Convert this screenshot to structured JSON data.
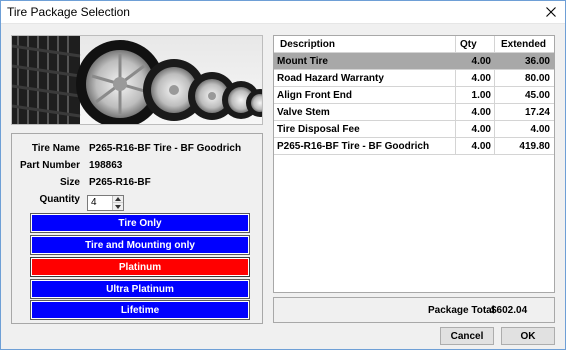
{
  "window": {
    "title": "Tire Package Selection",
    "close_icon": "close-icon"
  },
  "tire_info": {
    "tire_name_label": "Tire Name",
    "tire_name": "P265-R16-BF Tire - BF Goodrich",
    "part_number_label": "Part Number",
    "part_number": "198863",
    "size_label": "Size",
    "size": "P265-R16-BF",
    "quantity_label": "Quantity",
    "quantity": "4"
  },
  "packages": [
    {
      "label": "Tire Only",
      "selected": false
    },
    {
      "label": "Tire and Mounting only",
      "selected": false
    },
    {
      "label": "Platinum",
      "selected": true
    },
    {
      "label": "Ultra Platinum",
      "selected": false
    },
    {
      "label": "Lifetime",
      "selected": false
    }
  ],
  "grid": {
    "columns": [
      "Description",
      "Qty",
      "Extended"
    ],
    "rows": [
      {
        "description": "Mount Tire",
        "qty": "4.00",
        "extended": "36.00"
      },
      {
        "description": "Road Hazard Warranty",
        "qty": "4.00",
        "extended": "80.00"
      },
      {
        "description": "Align Front End",
        "qty": "1.00",
        "extended": "45.00"
      },
      {
        "description": "Valve Stem",
        "qty": "4.00",
        "extended": "17.24"
      },
      {
        "description": "Tire Disposal Fee",
        "qty": "4.00",
        "extended": "4.00"
      },
      {
        "description": "P265-R16-BF Tire - BF Goodrich",
        "qty": "4.00",
        "extended": "419.80"
      }
    ]
  },
  "total": {
    "label": "Package Total",
    "value": "$602.04"
  },
  "buttons": {
    "cancel": "Cancel",
    "ok": "OK"
  },
  "colors": {
    "package_button": "#0000ff",
    "package_button_selected": "#ff0000",
    "selected_row": "#a8a8a8"
  }
}
